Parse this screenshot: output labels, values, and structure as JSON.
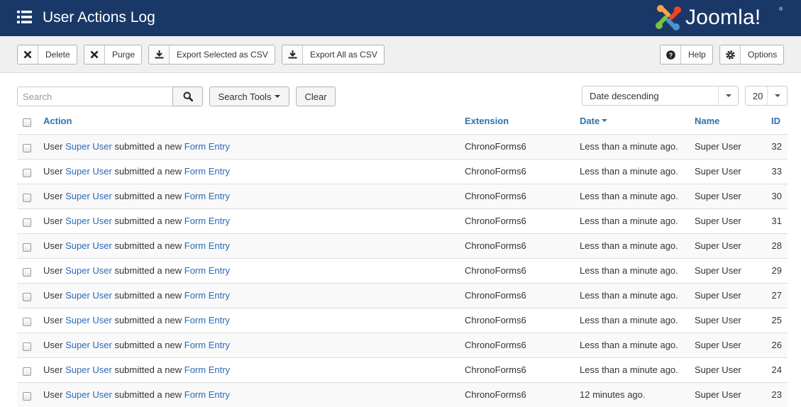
{
  "header": {
    "title": "User Actions Log",
    "brand": "Joomla!",
    "brand_colors": [
      "#f9a541",
      "#f44321",
      "#5091cd",
      "#7ac143"
    ],
    "background": "#1a3867"
  },
  "toolbar": {
    "delete_label": "Delete",
    "purge_label": "Purge",
    "export_selected_label": "Export Selected as CSV",
    "export_all_label": "Export All as CSV",
    "help_label": "Help",
    "options_label": "Options"
  },
  "filters": {
    "search_placeholder": "Search",
    "search_tools_label": "Search Tools",
    "clear_label": "Clear",
    "ordering_value": "Date descending",
    "limit_value": "20"
  },
  "table": {
    "columns": {
      "action": "Action",
      "extension": "Extension",
      "date": "Date",
      "name": "Name",
      "id": "ID"
    },
    "rows": [
      {
        "prefix": "User",
        "user": "Super User",
        "middle": "submitted a new",
        "item": "Form Entry",
        "extension": "ChronoForms6",
        "date": "Less than a minute ago.",
        "name": "Super User",
        "id": "32"
      },
      {
        "prefix": "User",
        "user": "Super User",
        "middle": "submitted a new",
        "item": "Form Entry",
        "extension": "ChronoForms6",
        "date": "Less than a minute ago.",
        "name": "Super User",
        "id": "33"
      },
      {
        "prefix": "User",
        "user": "Super User",
        "middle": "submitted a new",
        "item": "Form Entry",
        "extension": "ChronoForms6",
        "date": "Less than a minute ago.",
        "name": "Super User",
        "id": "30"
      },
      {
        "prefix": "User",
        "user": "Super User",
        "middle": "submitted a new",
        "item": "Form Entry",
        "extension": "ChronoForms6",
        "date": "Less than a minute ago.",
        "name": "Super User",
        "id": "31"
      },
      {
        "prefix": "User",
        "user": "Super User",
        "middle": "submitted a new",
        "item": "Form Entry",
        "extension": "ChronoForms6",
        "date": "Less than a minute ago.",
        "name": "Super User",
        "id": "28"
      },
      {
        "prefix": "User",
        "user": "Super User",
        "middle": "submitted a new",
        "item": "Form Entry",
        "extension": "ChronoForms6",
        "date": "Less than a minute ago.",
        "name": "Super User",
        "id": "29"
      },
      {
        "prefix": "User",
        "user": "Super User",
        "middle": "submitted a new",
        "item": "Form Entry",
        "extension": "ChronoForms6",
        "date": "Less than a minute ago.",
        "name": "Super User",
        "id": "27"
      },
      {
        "prefix": "User",
        "user": "Super User",
        "middle": "submitted a new",
        "item": "Form Entry",
        "extension": "ChronoForms6",
        "date": "Less than a minute ago.",
        "name": "Super User",
        "id": "25"
      },
      {
        "prefix": "User",
        "user": "Super User",
        "middle": "submitted a new",
        "item": "Form Entry",
        "extension": "ChronoForms6",
        "date": "Less than a minute ago.",
        "name": "Super User",
        "id": "26"
      },
      {
        "prefix": "User",
        "user": "Super User",
        "middle": "submitted a new",
        "item": "Form Entry",
        "extension": "ChronoForms6",
        "date": "Less than a minute ago.",
        "name": "Super User",
        "id": "24"
      },
      {
        "prefix": "User",
        "user": "Super User",
        "middle": "submitted a new",
        "item": "Form Entry",
        "extension": "ChronoForms6",
        "date": "12 minutes ago.",
        "name": "Super User",
        "id": "23"
      }
    ]
  }
}
